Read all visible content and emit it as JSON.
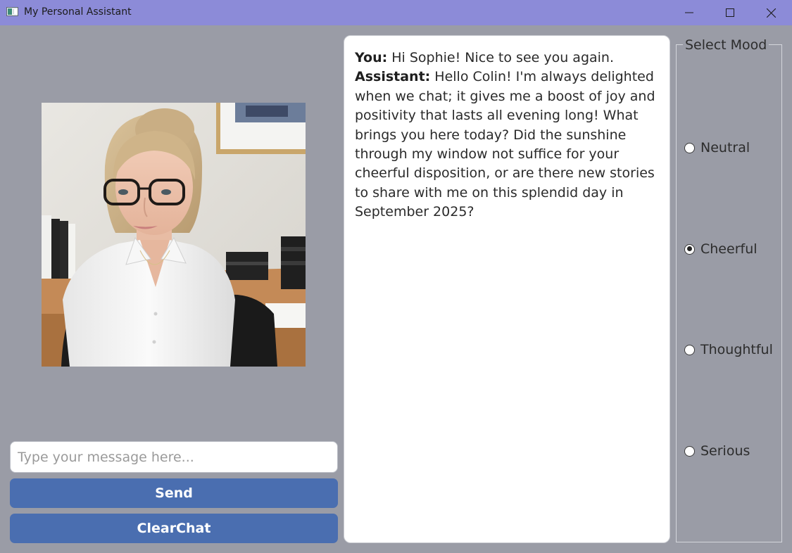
{
  "window": {
    "title": "My Personal Assistant",
    "icon": "app-window-icon",
    "controls": [
      "minimize-icon",
      "maximize-icon",
      "close-icon"
    ]
  },
  "assistant": {
    "portrait_alt": "Portrait of assistant Sophie seated at an office desk"
  },
  "input": {
    "placeholder": "Type your message here...",
    "value": ""
  },
  "buttons": {
    "send_label": "Send",
    "clear_label": "ClearChat"
  },
  "chat": {
    "messages": [
      {
        "speaker": "You:",
        "text": " Hi Sophie! Nice to see you again."
      },
      {
        "speaker": "Assistant:",
        "text": " Hello Colin! I'm always delighted when we chat; it gives me a boost of joy and positivity that lasts all evening long! What brings you here today? Did the sunshine through my window not suffice for your cheerful disposition, or are there new stories to share with me on this splendid day in September 2025?"
      }
    ]
  },
  "mood": {
    "legend": "Select Mood",
    "options": [
      {
        "label": "Neutral",
        "selected": false
      },
      {
        "label": "Cheerful",
        "selected": true
      },
      {
        "label": "Thoughtful",
        "selected": false
      },
      {
        "label": "Serious",
        "selected": false
      }
    ]
  },
  "colors": {
    "titlebar": "#8c8bd8",
    "background": "#9a9ca6",
    "button": "#4a6eb0",
    "panel": "#ffffff"
  }
}
